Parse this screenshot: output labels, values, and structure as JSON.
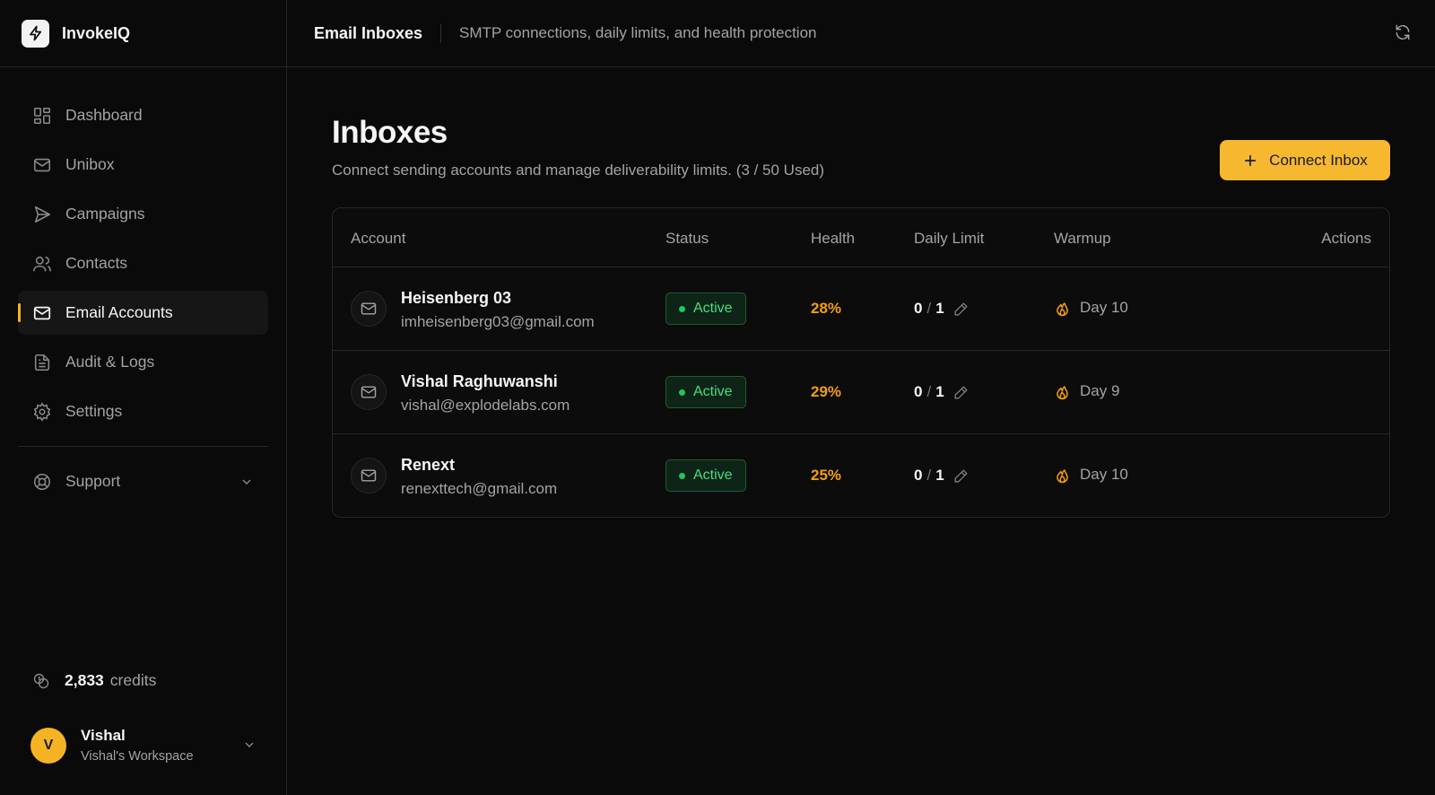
{
  "app": {
    "name": "InvokeIQ"
  },
  "topbar": {
    "title": "Email Inboxes",
    "subtitle": "SMTP connections, daily limits, and health protection"
  },
  "sidebar": {
    "items": [
      {
        "label": "Dashboard",
        "icon": "dashboard-icon"
      },
      {
        "label": "Unibox",
        "icon": "mail-icon"
      },
      {
        "label": "Campaigns",
        "icon": "send-icon"
      },
      {
        "label": "Contacts",
        "icon": "users-icon"
      },
      {
        "label": "Email Accounts",
        "icon": "mail-icon",
        "active": true
      },
      {
        "label": "Audit & Logs",
        "icon": "file-text-icon"
      },
      {
        "label": "Settings",
        "icon": "gear-icon"
      }
    ],
    "support": {
      "label": "Support",
      "icon": "lifebuoy-icon"
    },
    "credits": {
      "value": "2,833",
      "label": "credits"
    },
    "user": {
      "initial": "V",
      "name": "Vishal",
      "workspace": "Vishal's Workspace"
    }
  },
  "main": {
    "title": "Inboxes",
    "subtitle": "Connect sending accounts and manage deliverability limits. (3 / 50 Used)",
    "connect_label": "Connect Inbox",
    "table": {
      "headers": {
        "account": "Account",
        "status": "Status",
        "health": "Health",
        "daily_limit": "Daily Limit",
        "warmup": "Warmup",
        "actions": "Actions"
      },
      "rows": [
        {
          "name": "Heisenberg 03",
          "email": "imheisenberg03@gmail.com",
          "status": "Active",
          "health": "28%",
          "used": "0",
          "limit": "1",
          "warmup": "Day 10"
        },
        {
          "name": "Vishal Raghuwanshi",
          "email": "vishal@explodelabs.com",
          "status": "Active",
          "health": "29%",
          "used": "0",
          "limit": "1",
          "warmup": "Day 9"
        },
        {
          "name": "Renext",
          "email": "renexttech@gmail.com",
          "status": "Active",
          "health": "25%",
          "used": "0",
          "limit": "1",
          "warmup": "Day 10"
        }
      ]
    }
  },
  "colors": {
    "accent": "#f5b82e",
    "health": "#f59e0b",
    "status_active": "#4ade80",
    "background": "#0a0a0a"
  }
}
